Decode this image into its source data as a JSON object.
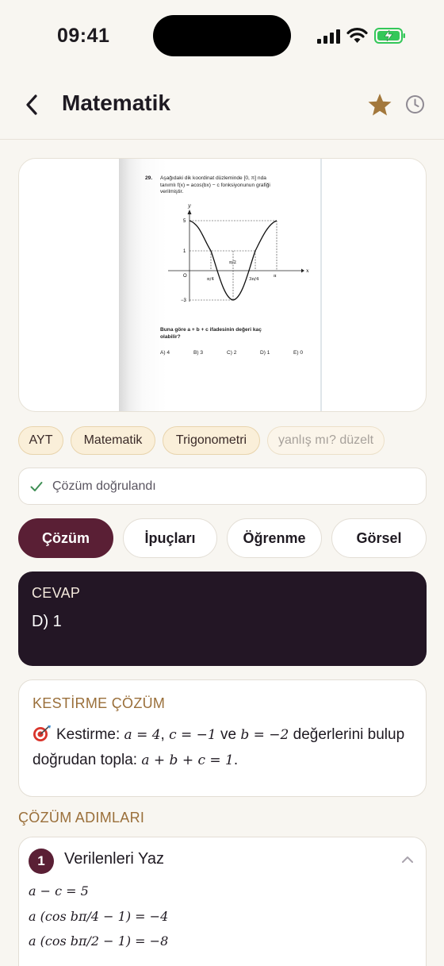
{
  "status_bar": {
    "time": "09:41"
  },
  "header": {
    "title": "Matematik",
    "back_icon": "chevron-left-icon",
    "star_icon": "star-icon",
    "history_icon": "clock-icon",
    "star_color": "#a3783c"
  },
  "question_image": {
    "number": "29.",
    "text": "Aşağıdaki dik koordinat düzleminde [0, π] nda tanımlı f(x) = acos(bx) − c fonksiyonunun grafiği verilmiştir.",
    "question": "Buna göre a + b + c ifadesinin değeri kaç olabilir?",
    "options": [
      "A) 4",
      "B) 3",
      "C) 2",
      "D) 1",
      "E) 0"
    ],
    "graph_labels": {
      "y": "y",
      "x": "x",
      "y5": "5",
      "y1": "1",
      "ym3": "−3",
      "origin": "O",
      "pi4": "π/4",
      "pi2": "π/2",
      "threepi4": "3π/4",
      "pi": "π"
    }
  },
  "tags": [
    "AYT",
    "Matematik",
    "Trigonometri"
  ],
  "fix_tag": "yanlış mı? düzelt",
  "verified": {
    "text": "Çözüm doğrulandı"
  },
  "tabs": [
    "Çözüm",
    "İpuçları",
    "Öğrenme",
    "Görsel"
  ],
  "active_tab": "Çözüm",
  "answer": {
    "label": "CEVAP",
    "value": "D) 1"
  },
  "shortcut": {
    "label": "KESTİRME ÇÖZÜM",
    "t1": "Kestirme: ",
    "m1": "a = 4",
    "t2": ", ",
    "m2": "c = −1",
    "t3": " ve ",
    "m3": "b = −2",
    "t4": " değerlerini bulup doğrudan topla: ",
    "m4": "a + b + c = 1",
    "t5": "."
  },
  "steps_title": "ÇÖZÜM ADIMLARI",
  "steps": [
    {
      "number": "1",
      "title": "Verilenleri Yaz",
      "equations": [
        "a − c = 5",
        "a (cos bπ/4 − 1) = −4",
        "a (cos bπ/2 − 1) = −8"
      ]
    }
  ],
  "colors": {
    "accent": "#5a1f35",
    "answer_bg": "#231625",
    "section_label": "#9a6f3a",
    "chip_bg": "#faefd9"
  }
}
